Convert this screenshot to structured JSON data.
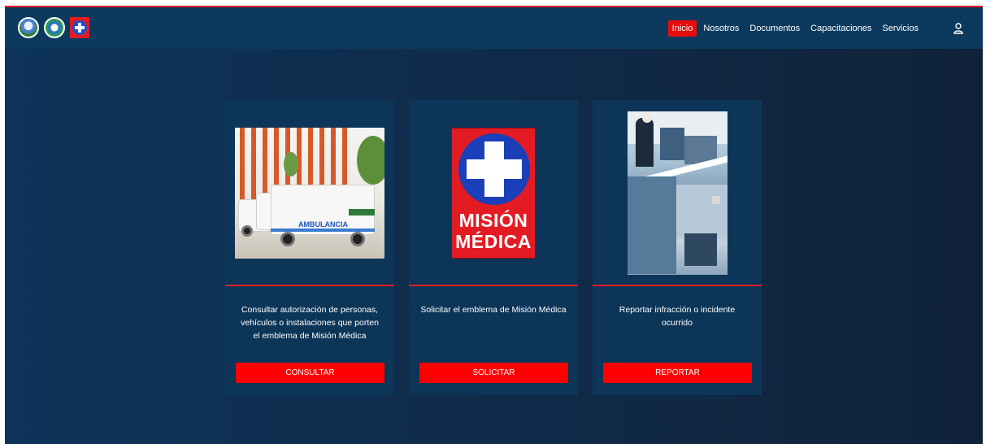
{
  "nav": {
    "items": [
      {
        "label": "Inicio",
        "active": true
      },
      {
        "label": "Nosotros",
        "active": false
      },
      {
        "label": "Documentos",
        "active": false
      },
      {
        "label": "Capacitaciones",
        "active": false
      },
      {
        "label": "Servicios",
        "active": false
      }
    ],
    "user_icon": "user-icon"
  },
  "logos": [
    "gobernacion-logo",
    "secretaria-salud-logo",
    "mision-medica-logo"
  ],
  "cards": [
    {
      "image": "ambulance-photo",
      "image_text": "AMBULANCIA",
      "description": "Consultar autorización de personas, vehículos o instalaciones que porten el emblema de Misión Médica",
      "button": "CONSULTAR"
    },
    {
      "image": "mision-medica-emblem",
      "image_text_1": "MISIÓN",
      "image_text_2": "MÉDICA",
      "description": "Solicitar el emblema de Misión Médica",
      "button": "SOLICITAR"
    },
    {
      "image": "incident-photo",
      "description": "Reportar infracción o incidente ocurrido",
      "button": "REPORTAR"
    }
  ],
  "colors": {
    "accent_red": "#ff0000",
    "navbar": "#0b3a5e",
    "card": "#0c3558"
  }
}
